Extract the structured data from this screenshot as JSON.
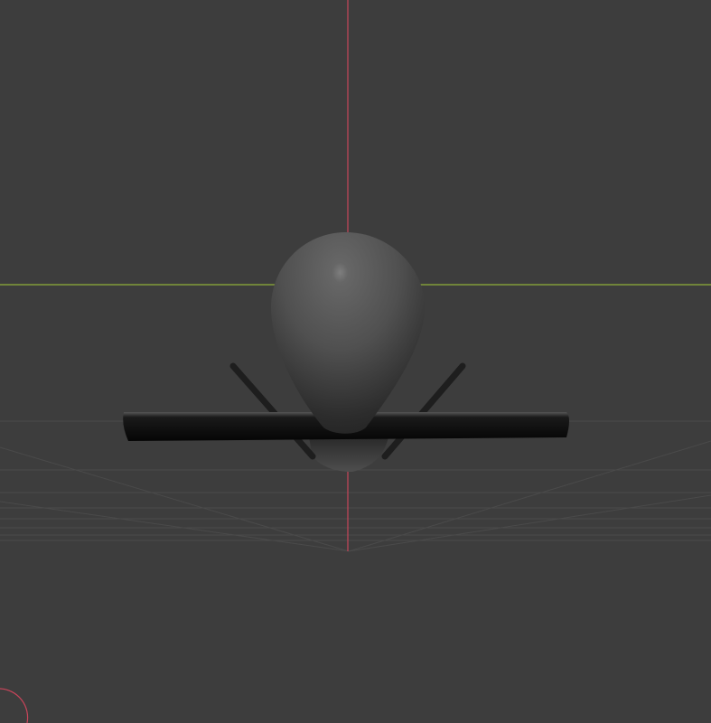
{
  "viewport": {
    "background_color": "#3d3d3d",
    "grid_color": "#4a4a4a",
    "x_axis_color": "#8fae3a",
    "z_axis_color": "#c8455a",
    "gizmo_color": "#c8455a"
  },
  "model": {
    "body_color": "#555555",
    "wing_color": "#111111",
    "strut_color": "#1e1e1e"
  }
}
